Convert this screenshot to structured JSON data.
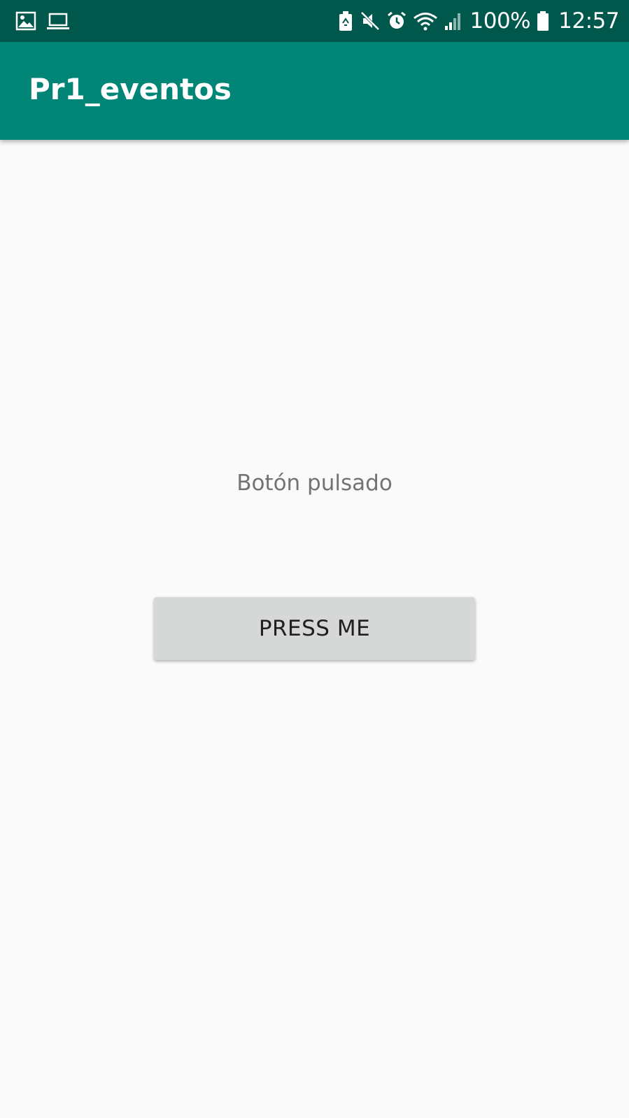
{
  "status_bar": {
    "left_icons": [
      "gallery-icon",
      "laptop-icon"
    ],
    "right_icons": [
      "battery-saver-icon",
      "mute-icon",
      "alarm-icon",
      "wifi-icon",
      "signal-icon"
    ],
    "battery_percent": "100%",
    "time": "12:57",
    "color": "#00574b"
  },
  "app_bar": {
    "title": "Pr1_eventos",
    "color": "#008577"
  },
  "content": {
    "result_text": "Botón pulsado",
    "button_label": "PRESS ME"
  },
  "colors": {
    "background": "#fafafa",
    "button_bg": "#d6d7d7",
    "result_text": "#737373"
  }
}
